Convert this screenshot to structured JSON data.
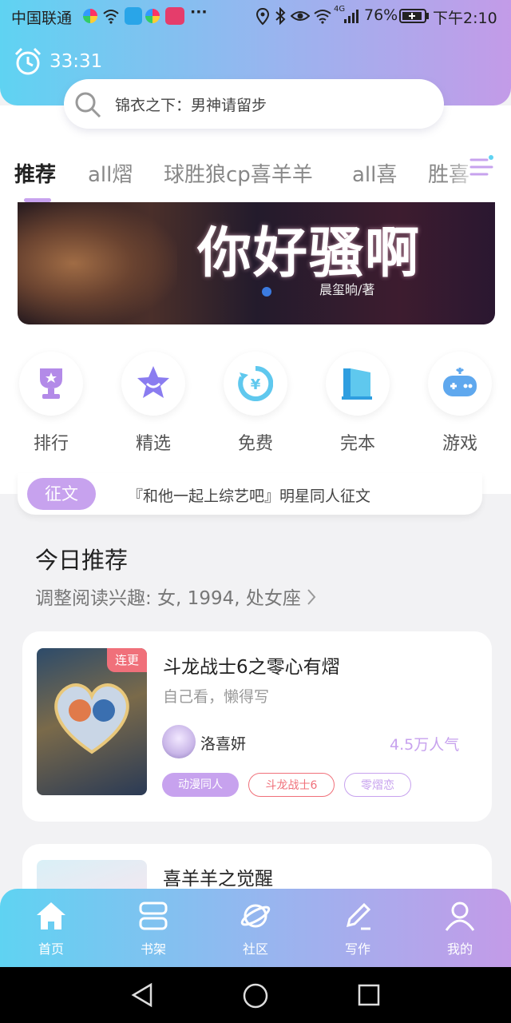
{
  "status_bar": {
    "carrier": "中国联通",
    "signal_label": "4G",
    "battery": "76%",
    "time": "下午2:10"
  },
  "timer": {
    "value": "33:31"
  },
  "search": {
    "placeholder_text": "锦衣之下：男神请留步"
  },
  "tabs": [
    {
      "label": "推荐"
    },
    {
      "label": "all熠"
    },
    {
      "label": "球胜狼cp喜羊羊"
    },
    {
      "label": "all喜"
    },
    {
      "label": "胜喜"
    }
  ],
  "banner": {
    "title": "你好骚啊",
    "author": "晨玺晌/著"
  },
  "categories": [
    {
      "label": "排行",
      "icon": "trophy-icon"
    },
    {
      "label": "精选",
      "icon": "star-icon"
    },
    {
      "label": "免费",
      "icon": "free-yen-icon"
    },
    {
      "label": "完本",
      "icon": "book-icon"
    },
    {
      "label": "游戏",
      "icon": "gamepad-icon"
    }
  ],
  "contest": {
    "badge": "征文",
    "text": "『和他一起上综艺吧』明星同人征文"
  },
  "today": {
    "title": "今日推荐",
    "prefs": "调整阅读兴趣: 女, 1994, 处女座"
  },
  "books": [
    {
      "title": "斗龙战士6之零心有熠",
      "subtitle": "自己看，懒得写",
      "badge": "连更",
      "author": "洛喜妍",
      "popularity": "4.5万人气",
      "tags": [
        "动漫同人",
        "斗龙战士6",
        "零熠恋"
      ]
    },
    {
      "title": "喜羊羊之觉醒"
    }
  ],
  "nav": [
    {
      "label": "首页",
      "icon": "home-icon"
    },
    {
      "label": "书架",
      "icon": "bookshelf-icon"
    },
    {
      "label": "社区",
      "icon": "planet-icon"
    },
    {
      "label": "写作",
      "icon": "pen-icon"
    },
    {
      "label": "我的",
      "icon": "user-icon"
    }
  ],
  "colors": {
    "gradient_start": "#5fd3f2",
    "gradient_end": "#c39be8",
    "accent_purple": "#c7a2ee",
    "badge_red": "#f0707a"
  }
}
